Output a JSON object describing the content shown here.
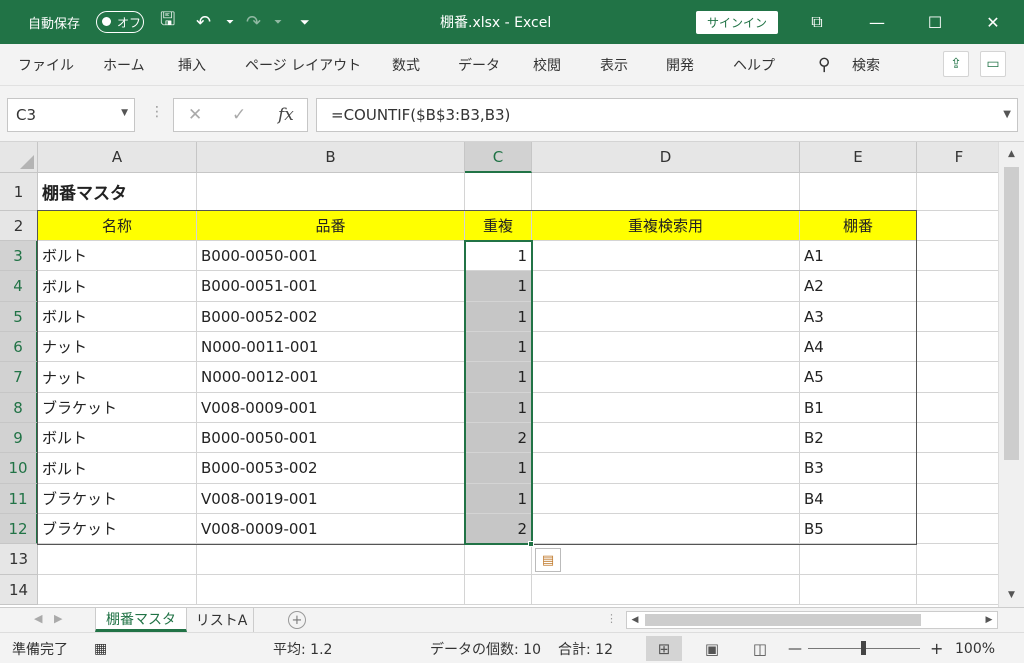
{
  "titlebar": {
    "autosave_label": "自動保存",
    "autosave_state": "オフ",
    "doc_title": "棚番.xlsx  -  Excel",
    "signin": "サインイン",
    "save_icon": "🖫",
    "undo_icon": "↶",
    "redo_icon": "↷",
    "qat_more_icon": "⏷",
    "ribbon_display_icon": "⧉",
    "minimize_icon": "—",
    "maximize_icon": "☐",
    "close_icon": "✕"
  },
  "ribbon": {
    "tabs": [
      "ファイル",
      "ホーム",
      "挿入",
      "ページ レイアウト",
      "数式",
      "データ",
      "校閲",
      "表示",
      "開発",
      "ヘルプ"
    ],
    "search_label": "検索",
    "search_icon": "⚲",
    "share_icon": "⇪",
    "comment_icon": "▭"
  },
  "formula_bar": {
    "name_box": "C3",
    "cancel_icon": "✕",
    "enter_icon": "✓",
    "fx": "fx",
    "formula": "=COUNTIF($B$3:B3,B3)"
  },
  "grid": {
    "columns": [
      "A",
      "B",
      "C",
      "D",
      "E",
      "F"
    ],
    "row_numbers": [
      "1",
      "2",
      "3",
      "4",
      "5",
      "6",
      "7",
      "8",
      "9",
      "10",
      "11",
      "12",
      "13",
      "14"
    ],
    "title": "棚番マスタ",
    "headers": [
      "名称",
      "品番",
      "重複",
      "重複検索用",
      "棚番"
    ],
    "rows": [
      [
        "ボルト",
        "B000-0050-001",
        "1",
        "",
        "A1"
      ],
      [
        "ボルト",
        "B000-0051-001",
        "1",
        "",
        "A2"
      ],
      [
        "ボルト",
        "B000-0052-002",
        "1",
        "",
        "A3"
      ],
      [
        "ナット",
        "N000-0011-001",
        "1",
        "",
        "A4"
      ],
      [
        "ナット",
        "N000-0012-001",
        "1",
        "",
        "A5"
      ],
      [
        "ブラケット",
        "V008-0009-001",
        "1",
        "",
        "B1"
      ],
      [
        "ボルト",
        "B000-0050-001",
        "2",
        "",
        "B2"
      ],
      [
        "ボルト",
        "B000-0053-002",
        "1",
        "",
        "B3"
      ],
      [
        "ブラケット",
        "V008-0019-001",
        "1",
        "",
        "B4"
      ],
      [
        "ブラケット",
        "V008-0009-001",
        "2",
        "",
        "B5"
      ]
    ]
  },
  "sheets": {
    "tabs": [
      "棚番マスタ",
      "リストA"
    ],
    "active": 0,
    "add_icon": "+"
  },
  "statusbar": {
    "ready": "準備完了",
    "average": "平均: 1.2",
    "count": "データの個数: 10",
    "sum": "合計: 12",
    "zoom": "100%",
    "zoom_out_icon": "—",
    "zoom_in_icon": "+"
  }
}
